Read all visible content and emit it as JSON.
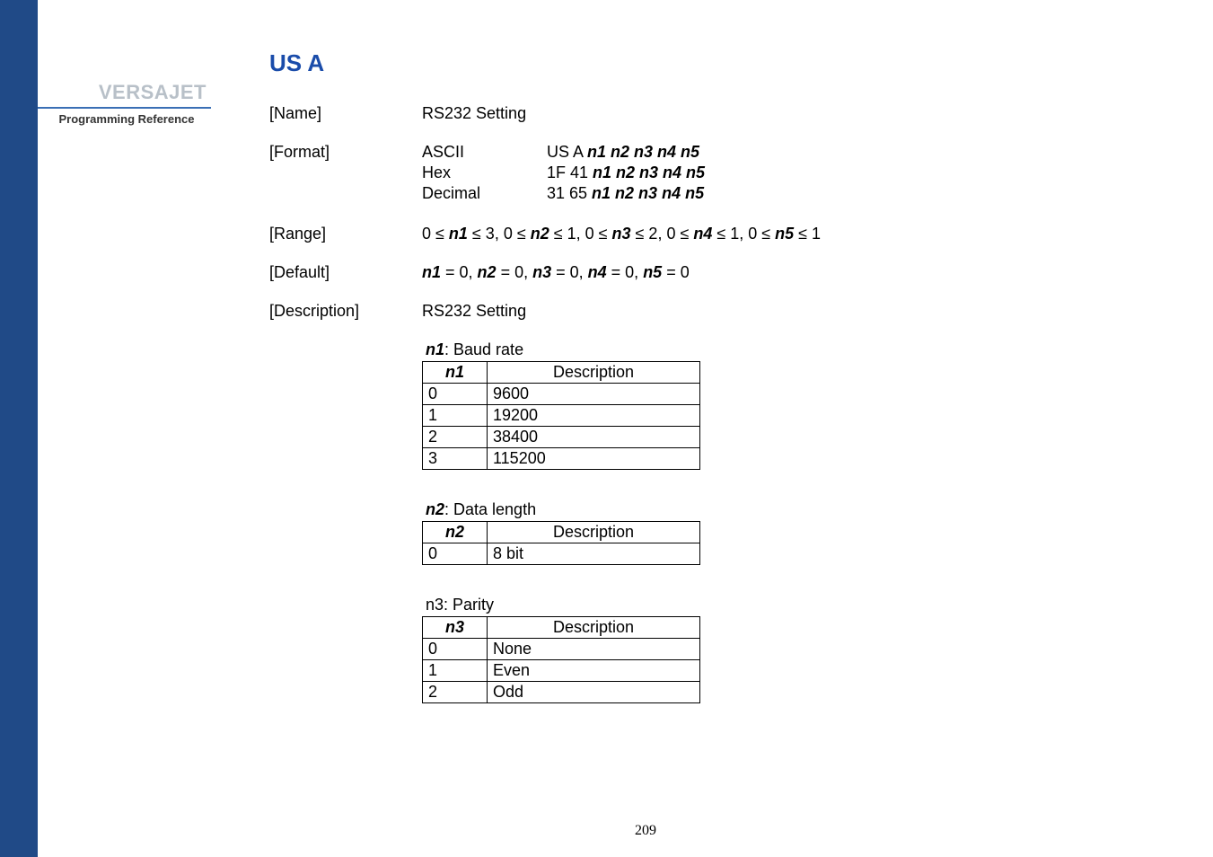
{
  "sidebar": {
    "brand": "VERSAJET",
    "subtitle": "Programming Reference"
  },
  "title": "US A",
  "rows": {
    "name": {
      "label": "[Name]",
      "value": "RS232 Setting"
    },
    "format": {
      "label": "[Format]",
      "lines": [
        {
          "key": "ASCII",
          "prefix": "US A ",
          "params": "n1 n2 n3 n4 n5"
        },
        {
          "key": "Hex",
          "prefix": "1F 41 ",
          "params": "n1 n2 n3 n4 n5"
        },
        {
          "key": "Decimal",
          "prefix": "31 65 ",
          "params": "n1 n2 n3 n4 n5"
        }
      ]
    },
    "range": {
      "label": "[Range]",
      "parts": [
        "0 ≤ ",
        "n1",
        " ≤ 3, 0 ≤ ",
        "n2",
        " ≤ 1, 0 ≤ ",
        "n3",
        " ≤ 2, 0 ≤ ",
        "n4",
        " ≤ 1, 0 ≤ ",
        "n5",
        " ≤ 1"
      ]
    },
    "default": {
      "label": "[Default]",
      "parts": [
        "n1",
        " = 0, ",
        "n2",
        " = 0, ",
        "n3",
        " = 0, ",
        "n4",
        " = 0, ",
        "n5",
        " = 0"
      ]
    },
    "description": {
      "label": "[Description]",
      "value": "RS232 Setting"
    }
  },
  "tables": [
    {
      "caption_param": "n1",
      "caption_rest": ": Baud rate",
      "header_param": "n1",
      "header_desc": "Description",
      "rows": [
        {
          "v": "0",
          "d": "9600"
        },
        {
          "v": "1",
          "d": "19200"
        },
        {
          "v": "2",
          "d": "38400"
        },
        {
          "v": "3",
          "d": "115200"
        }
      ]
    },
    {
      "caption_param": "n2",
      "caption_rest": ": Data length",
      "header_param": "n2",
      "header_desc": "Description",
      "rows": [
        {
          "v": "0",
          "d": "8 bit"
        }
      ]
    },
    {
      "caption_plain": "n3: Parity",
      "header_param": "n3",
      "header_desc": "Description",
      "rows": [
        {
          "v": "0",
          "d": "None"
        },
        {
          "v": "1",
          "d": "Even"
        },
        {
          "v": "2",
          "d": "Odd"
        }
      ]
    }
  ],
  "page_number": "209",
  "chart_data": {
    "type": "table",
    "tables": [
      {
        "name": "n1 Baud rate",
        "columns": [
          "n1",
          "Description"
        ],
        "rows": [
          [
            "0",
            "9600"
          ],
          [
            "1",
            "19200"
          ],
          [
            "2",
            "38400"
          ],
          [
            "3",
            "115200"
          ]
        ]
      },
      {
        "name": "n2 Data length",
        "columns": [
          "n2",
          "Description"
        ],
        "rows": [
          [
            "0",
            "8 bit"
          ]
        ]
      },
      {
        "name": "n3 Parity",
        "columns": [
          "n3",
          "Description"
        ],
        "rows": [
          [
            "0",
            "None"
          ],
          [
            "1",
            "Even"
          ],
          [
            "2",
            "Odd"
          ]
        ]
      }
    ]
  }
}
